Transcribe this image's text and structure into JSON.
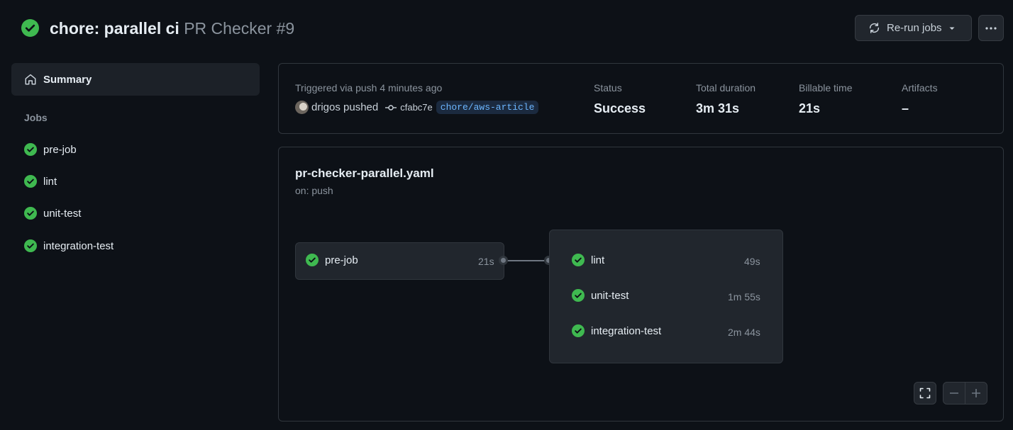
{
  "header": {
    "title": "chore: parallel ci",
    "workflow_run": "PR Checker #9",
    "rerun_label": "Re-run jobs"
  },
  "sidebar": {
    "summary_label": "Summary",
    "jobs_heading": "Jobs",
    "jobs": [
      {
        "label": "pre-job",
        "status": "success"
      },
      {
        "label": "lint",
        "status": "success"
      },
      {
        "label": "unit-test",
        "status": "success"
      },
      {
        "label": "integration-test",
        "status": "success"
      }
    ]
  },
  "run_info": {
    "trigger_text": "Triggered via push 4 minutes ago",
    "pusher_text": "drigos pushed",
    "commit_sha": "cfabc7e",
    "branch": "chore/aws-article",
    "status_label": "Status",
    "status_value": "Success",
    "duration_label": "Total duration",
    "duration_value": "3m 31s",
    "billable_label": "Billable time",
    "billable_value": "21s",
    "artifacts_label": "Artifacts",
    "artifacts_value": "–"
  },
  "workflow": {
    "file": "pr-checker-parallel.yaml",
    "trigger": "on: push",
    "first_job": {
      "label": "pre-job",
      "duration": "21s"
    },
    "parallel_jobs": [
      {
        "label": "lint",
        "duration": "49s"
      },
      {
        "label": "unit-test",
        "duration": "1m 55s"
      },
      {
        "label": "integration-test",
        "duration": "2m 44s"
      }
    ]
  },
  "colors": {
    "background": "#0d1117",
    "success": "#3fb950",
    "branch_text": "#6cb6ff"
  },
  "icons": {
    "status": "check-circle-icon",
    "rerun": "sync-icon",
    "more": "kebab-horizontal-icon",
    "summary": "home-icon",
    "commit": "git-commit-icon",
    "fit": "fullscreen-icon",
    "zoom_out": "minus-icon",
    "zoom_in": "plus-icon"
  }
}
